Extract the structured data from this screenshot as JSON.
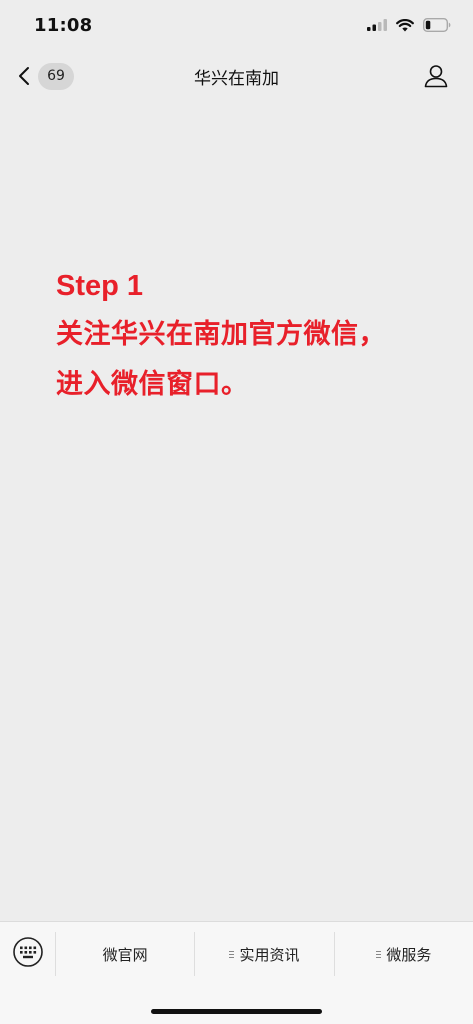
{
  "status_bar": {
    "time": "11:08",
    "signal_icon": "cellular-signal-icon",
    "wifi_icon": "wifi-icon",
    "battery_icon": "battery-icon"
  },
  "nav": {
    "back_icon": "chevron-left-icon",
    "unread_count": "69",
    "title": "华兴在南加",
    "profile_icon": "person-icon"
  },
  "message": {
    "step": "Step 1",
    "lines": [
      "关注华兴在南加官方微信，",
      "进入微信窗口。"
    ],
    "color": "#e8202a"
  },
  "bottom_menu": {
    "keyboard_icon": "keyboard-icon",
    "items": [
      {
        "label": "微官网",
        "has_submenu": false
      },
      {
        "label": "实用资讯",
        "has_submenu": true
      },
      {
        "label": "微服务",
        "has_submenu": true
      }
    ]
  }
}
